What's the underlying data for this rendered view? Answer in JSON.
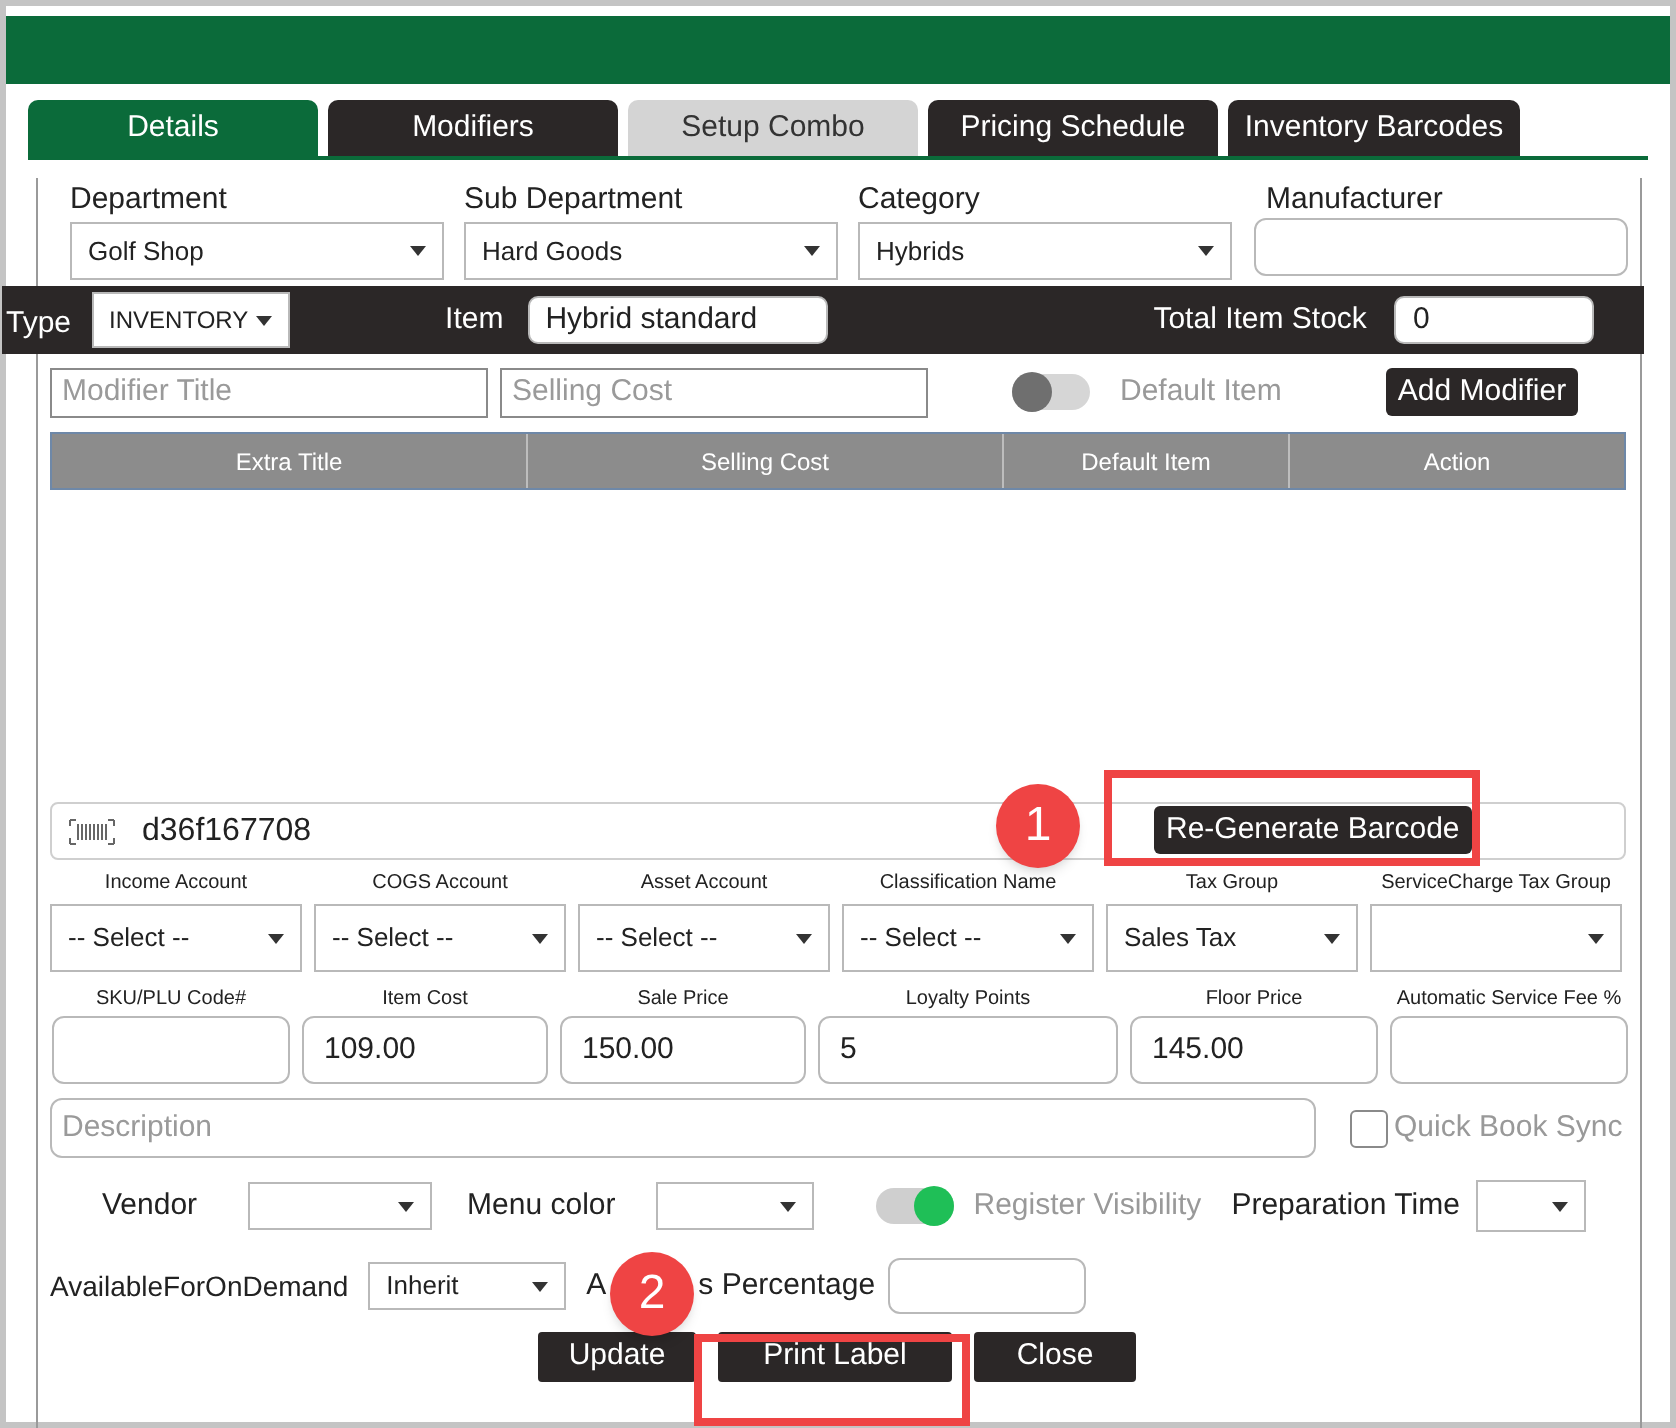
{
  "tabs": [
    {
      "label": "Details",
      "selected": true,
      "disabled": false
    },
    {
      "label": "Modifiers",
      "selected": false,
      "disabled": false
    },
    {
      "label": "Setup Combo",
      "selected": false,
      "disabled": true
    },
    {
      "label": "Pricing Schedule",
      "selected": false,
      "disabled": false
    },
    {
      "label": "Inventory Barcodes",
      "selected": false,
      "disabled": false
    }
  ],
  "classification": [
    {
      "label": "Department",
      "kind": "select",
      "value": "Golf Shop"
    },
    {
      "label": "Sub Department",
      "kind": "select",
      "value": "Hard Goods"
    },
    {
      "label": "Category",
      "kind": "select",
      "value": "Hybrids"
    },
    {
      "label": "Manufacturer",
      "kind": "input"
    }
  ],
  "type_bar": {
    "type_label": "Type",
    "type_value": "INVENTORY",
    "item_label": "Item",
    "item_value": "Hybrid standard",
    "stock_label": "Total Item Stock",
    "stock_value": "0"
  },
  "modifier_form": {
    "title_placeholder": "Modifier Title",
    "cost_placeholder": "Selling Cost",
    "default_toggle": {
      "label": "Default Item",
      "on": false
    },
    "add_button": "Add Modifier"
  },
  "modifier_table": {
    "columns": [
      "Extra Title",
      "Selling Cost",
      "Default Item",
      "Action"
    ]
  },
  "barcode": {
    "value": "d36f167708",
    "button": "Re-Generate Barcode"
  },
  "accounts": [
    {
      "label": "Income Account",
      "value": "-- Select --"
    },
    {
      "label": "COGS Account",
      "value": "-- Select --"
    },
    {
      "label": "Asset Account",
      "value": "-- Select --"
    },
    {
      "label": "Classification Name",
      "value": "-- Select --"
    },
    {
      "label": "Tax Group",
      "value": "Sales Tax"
    },
    {
      "label": "ServiceCharge Tax Group"
    }
  ],
  "prices": [
    {
      "label": "SKU/PLU Code#"
    },
    {
      "label": "Item Cost",
      "value": "109.00"
    },
    {
      "label": "Sale Price",
      "value": "150.00"
    },
    {
      "label": "Loyalty Points",
      "value": "5"
    },
    {
      "label": "Floor Price",
      "value": "145.00"
    },
    {
      "label": "Automatic Service Fee %"
    }
  ],
  "description": {
    "placeholder": "Description"
  },
  "quick_book_sync": {
    "label": "Quick Book Sync",
    "checked": false
  },
  "vendor": {
    "label": "Vendor"
  },
  "menu_color": {
    "label": "Menu color"
  },
  "register_visibility": {
    "label": "Register Visibility",
    "on": true
  },
  "preparation_time": {
    "label": "Preparation Time"
  },
  "available_on_demand": {
    "label": "AvailableForOnDemand",
    "value": "Inherit"
  },
  "percentage_label_parts": [
    "A",
    "s Percentage"
  ],
  "buttons": [
    "Update",
    "Print Label",
    "Close"
  ],
  "annotations": [
    {
      "number": "1"
    },
    {
      "number": "2"
    }
  ]
}
